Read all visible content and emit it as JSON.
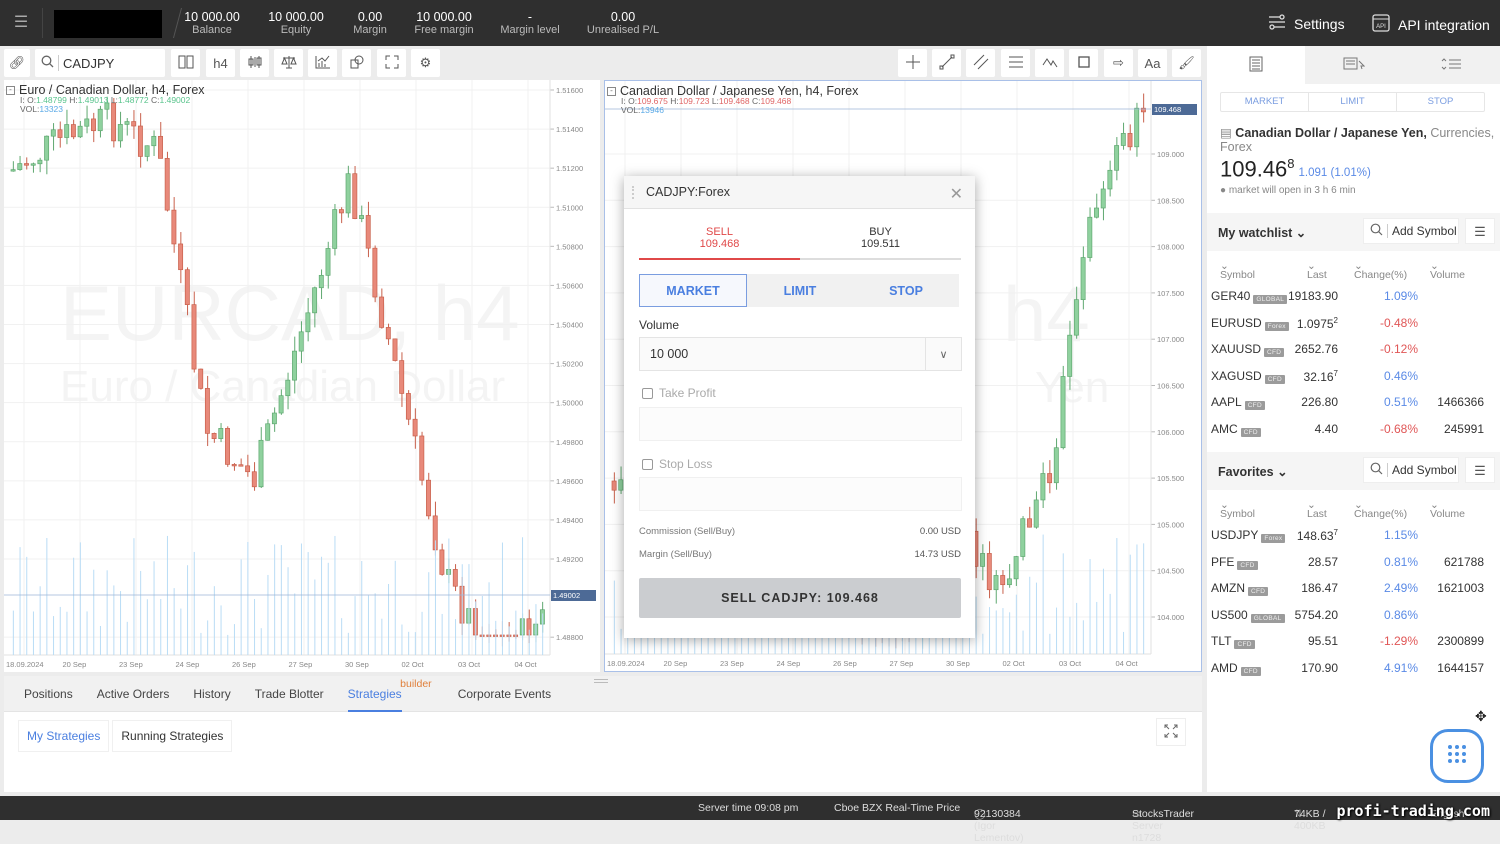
{
  "topbar": {
    "stats": [
      {
        "value": "10 000.00",
        "label": "Balance"
      },
      {
        "value": "10 000.00",
        "label": "Equity"
      },
      {
        "value": "0.00",
        "label": "Margin"
      },
      {
        "value": "10 000.00",
        "label": "Free margin"
      },
      {
        "value": "-",
        "label": "Margin level"
      },
      {
        "value": "0.00",
        "label": "Unrealised P/L"
      }
    ],
    "settings_label": "Settings",
    "api_label": "API integration"
  },
  "toolbar": {
    "symbol_value": "CADJPY",
    "timeframe_label": "h4",
    "drawing_text_label": "Aa"
  },
  "charts": [
    {
      "title": "Euro / Canadian Dollar,  h4,  Forex",
      "ohlc_prefix": "I:",
      "o_label": "O:",
      "o": "1.48799",
      "h_label": "H:",
      "h": "1.49013",
      "l_label": "L:",
      "l": "1.48772",
      "c_label": "C:",
      "c": "1.49002",
      "vol_label": "VOL:",
      "vol": "13323",
      "watermark_symbol": "EURCAD, h4",
      "watermark_name": "Euro / Canadian Dollar",
      "price_labels": [
        "1.51600",
        "1.51400",
        "1.51200",
        "1.51000",
        "1.50800",
        "1.50600",
        "1.50400",
        "1.50200",
        "1.50000",
        "1.49800",
        "1.49600",
        "1.49400",
        "1.49200",
        "1.48800"
      ],
      "current_price": "1.49002",
      "date_labels": [
        "18.09.2024",
        "20 Sep",
        "23 Sep",
        "24 Sep",
        "26 Sep",
        "27 Sep",
        "30 Sep",
        "02 Oct",
        "03 Oct",
        "04 Oct"
      ],
      "direction": "down"
    },
    {
      "title": "Canadian Dollar / Japanese Yen,  h4,  Forex",
      "ohlc_prefix": "I:",
      "o_label": "O:",
      "o": "109.675",
      "h_label": "H:",
      "h": "109.723",
      "l_label": "L:",
      "l": "109.468",
      "c_label": "C:",
      "c": "109.468",
      "vol_label": "VOL:",
      "vol": "13946",
      "watermark_symbol": "h4",
      "watermark_name": "Yen",
      "price_labels": [
        "109.000",
        "108.500",
        "108.000",
        "107.500",
        "107.000",
        "106.500",
        "106.000",
        "105.500",
        "105.000",
        "104.500",
        "104.000"
      ],
      "current_price": "109.468",
      "date_labels": [
        "18.09.2024",
        "20 Sep",
        "23 Sep",
        "24 Sep",
        "26 Sep",
        "27 Sep",
        "30 Sep",
        "02 Oct",
        "03 Oct",
        "04 Oct"
      ],
      "direction": "up"
    }
  ],
  "order_dialog": {
    "title": "CADJPY:Forex",
    "sell_label": "SELL",
    "sell_price": "109.468",
    "buy_label": "BUY",
    "buy_price": "109.511",
    "order_types": [
      "MARKET",
      "LIMIT",
      "STOP"
    ],
    "volume_label": "Volume",
    "volume_value": "10 000",
    "take_profit_label": "Take Profit",
    "stop_loss_label": "Stop Loss",
    "commission_label": "Commission (Sell/Buy)",
    "commission_value": "0.00 USD",
    "margin_label": "Margin (Sell/Buy)",
    "margin_value": "14.73 USD",
    "submit_label": "SELL CADJPY: 109.468"
  },
  "bottom_panel": {
    "tabs": [
      "Positions",
      "Active Orders",
      "History",
      "Trade Blotter",
      "Strategies",
      "Corporate Events"
    ],
    "strategies_badge": "builder",
    "subtabs": [
      "My Strategies",
      "Running Strategies"
    ]
  },
  "right_panel": {
    "order_types": [
      "MARKET",
      "LIMIT",
      "STOP"
    ],
    "symbol_name": "Canadian Dollar / Japanese Yen,",
    "symbol_category": "Currencies, Forex",
    "price_main": "109.46",
    "price_sup": "8",
    "price_change": "1.091 (1.01%)",
    "market_note": "market will open in 3 h 6 min",
    "add_symbol_label": "Add Symbol",
    "columns": [
      "Symbol",
      "Last",
      "Change(%)",
      "Volume"
    ],
    "watchlist": {
      "title": "My watchlist",
      "rows": [
        {
          "symbol": "GER40",
          "tag": "GLOBAL",
          "last": "19183.90",
          "sup": "",
          "change": "1.09%",
          "dir": "pos",
          "volume": ""
        },
        {
          "symbol": "EURUSD",
          "tag": "Forex",
          "last": "1.0975",
          "sup": "2",
          "change": "-0.48%",
          "dir": "neg",
          "volume": ""
        },
        {
          "symbol": "XAUUSD",
          "tag": "CFD",
          "last": "2652.76",
          "sup": "",
          "change": "-0.12%",
          "dir": "neg",
          "volume": ""
        },
        {
          "symbol": "XAGUSD",
          "tag": "CFD",
          "last": "32.16",
          "sup": "7",
          "change": "0.46%",
          "dir": "pos",
          "volume": ""
        },
        {
          "symbol": "AAPL",
          "tag": "CFD",
          "last": "226.80",
          "sup": "",
          "change": "0.51%",
          "dir": "pos",
          "volume": "1466366"
        },
        {
          "symbol": "AMC",
          "tag": "CFD",
          "last": "4.40",
          "sup": "",
          "change": "-0.68%",
          "dir": "neg",
          "volume": "245991"
        }
      ]
    },
    "favorites": {
      "title": "Favorites",
      "rows": [
        {
          "symbol": "USDJPY",
          "tag": "Forex",
          "last": "148.63",
          "sup": "7",
          "change": "1.15%",
          "dir": "pos",
          "volume": ""
        },
        {
          "symbol": "PFE",
          "tag": "CFD",
          "last": "28.57",
          "sup": "",
          "change": "0.81%",
          "dir": "pos",
          "volume": "621788"
        },
        {
          "symbol": "AMZN",
          "tag": "CFD",
          "last": "186.47",
          "sup": "",
          "change": "2.49%",
          "dir": "pos",
          "volume": "1621003"
        },
        {
          "symbol": "US500",
          "tag": "GLOBAL",
          "last": "5754.20",
          "sup": "",
          "change": "0.86%",
          "dir": "pos",
          "volume": ""
        },
        {
          "symbol": "TLT",
          "tag": "CFD",
          "last": "95.51",
          "sup": "",
          "change": "-1.29%",
          "dir": "neg",
          "volume": "2300899"
        },
        {
          "symbol": "AMD",
          "tag": "CFD",
          "last": "170.90",
          "sup": "",
          "change": "4.91%",
          "dir": "pos",
          "volume": "1644157"
        }
      ]
    }
  },
  "status_bar": {
    "server_time": "Server time 09:08 pm",
    "price_feed": "Cboe BZX Real-Time Price",
    "user": "92130384 (Igor Lementov)",
    "server": "StocksTrader Server n1728",
    "traffic": "74KB / 400KB",
    "language": "English",
    "watermark": "profi-trading.com"
  },
  "colors": {
    "up": "#8fd19e",
    "down": "#e8897a",
    "accent": "#4a7fe0",
    "sell": "#e04848"
  }
}
